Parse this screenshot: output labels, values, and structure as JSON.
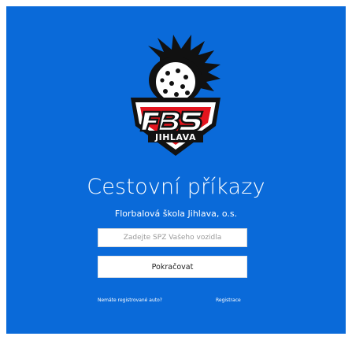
{
  "app": {
    "title": "Cestovní příkazy",
    "subtitle": "Florbalová škola Jihlava, o.s.",
    "brand_color": "#0a6ad9"
  },
  "logo": {
    "alt": "FBS Jihlava logo",
    "primary_text": "FBS",
    "secondary_text": "JIHLAVA",
    "colors": {
      "red": "#e4141e",
      "black": "#111111",
      "white": "#ffffff"
    }
  },
  "form": {
    "spz_placeholder": "Zadejte SPZ Vašeho vozidla",
    "spz_value": "",
    "submit_label": "Pokračovat"
  },
  "links": {
    "no_car_label": "Nemáte registrované auto?",
    "register_label": "Registrace"
  }
}
